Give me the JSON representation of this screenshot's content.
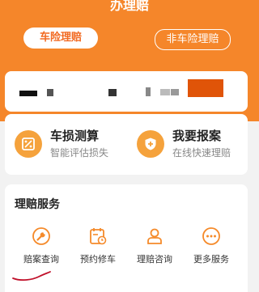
{
  "header": {
    "title": "办理赔"
  },
  "tabs": [
    {
      "label": "车险理赔",
      "active": true
    },
    {
      "label": "非车险理赔",
      "active": false
    }
  ],
  "quick_actions": [
    {
      "label": "车损测算",
      "sub": "智能评估损失",
      "icon": "percent-document-icon"
    },
    {
      "label": "我要报案",
      "sub": "在线快速理赔",
      "icon": "shield-plus-icon"
    }
  ],
  "services": {
    "title": "理赔服务",
    "items": [
      {
        "label": "赔案查询",
        "icon": "wrench-icon"
      },
      {
        "label": "预约修车",
        "icon": "calendar-clock-icon"
      },
      {
        "label": "理赔咨询",
        "icon": "person-icon"
      },
      {
        "label": "更多服务",
        "icon": "more-dots-icon"
      }
    ]
  },
  "colors": {
    "brand": "#f5862a",
    "accent": "#f26a22",
    "icon": "#f58a2a"
  }
}
